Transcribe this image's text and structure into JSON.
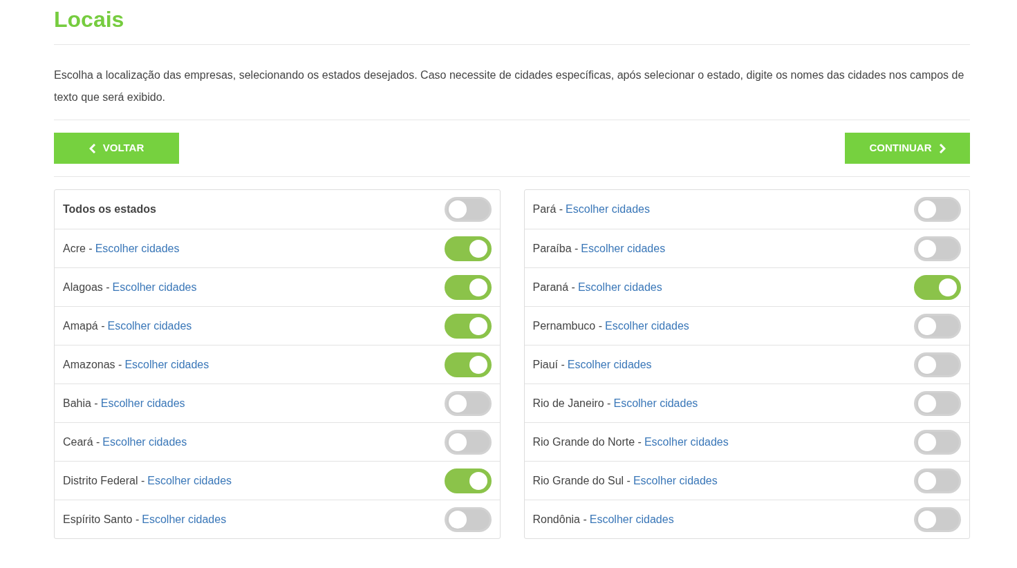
{
  "title": "Locais",
  "intro": "Escolha a localização das empresas, selecionando os estados desejados. Caso necessite de cidades específicas, após selecionar o estado, digite os nomes das cidades nos campos de texto que será exibido.",
  "buttons": {
    "back": "VOLTAR",
    "next": "CONTINUAR"
  },
  "columns": [
    [
      {
        "kind": "all",
        "label": "Todos os estados",
        "on": false
      },
      {
        "kind": "state",
        "label": "Acre -",
        "link": "Escolher cidades",
        "on": true
      },
      {
        "kind": "state",
        "label": "Alagoas -",
        "link": "Escolher cidades",
        "on": true
      },
      {
        "kind": "state",
        "label": "Amapá -",
        "link": "Escolher cidades",
        "on": true
      },
      {
        "kind": "state",
        "label": "Amazonas -",
        "link": "Escolher cidades",
        "on": true
      },
      {
        "kind": "state",
        "label": "Bahia -",
        "link": "Escolher cidades",
        "on": false
      },
      {
        "kind": "state",
        "label": "Ceará -",
        "link": "Escolher cidades",
        "on": false
      },
      {
        "kind": "state",
        "label": "Distrito Federal -",
        "link": "Escolher cidades",
        "on": true
      },
      {
        "kind": "state",
        "label": "Espírito Santo -",
        "link": "Escolher cidades",
        "on": false
      }
    ],
    [
      {
        "kind": "state",
        "label": "Pará -",
        "link": "Escolher cidades",
        "on": false
      },
      {
        "kind": "state",
        "label": "Paraíba -",
        "link": "Escolher cidades",
        "on": false
      },
      {
        "kind": "state",
        "label": "Paraná -",
        "link": "Escolher cidades",
        "on": true
      },
      {
        "kind": "state",
        "label": "Pernambuco -",
        "link": "Escolher cidades",
        "on": false
      },
      {
        "kind": "state",
        "label": "Piauí -",
        "link": "Escolher cidades",
        "on": false
      },
      {
        "kind": "state",
        "label": "Rio de Janeiro -",
        "link": "Escolher cidades",
        "on": false
      },
      {
        "kind": "state",
        "label": "Rio Grande do Norte -",
        "link": "Escolher cidades",
        "on": false
      },
      {
        "kind": "state",
        "label": "Rio Grande do Sul -",
        "link": "Escolher cidades",
        "on": false
      },
      {
        "kind": "state",
        "label": "Rondônia -",
        "link": "Escolher cidades",
        "on": false
      }
    ]
  ]
}
